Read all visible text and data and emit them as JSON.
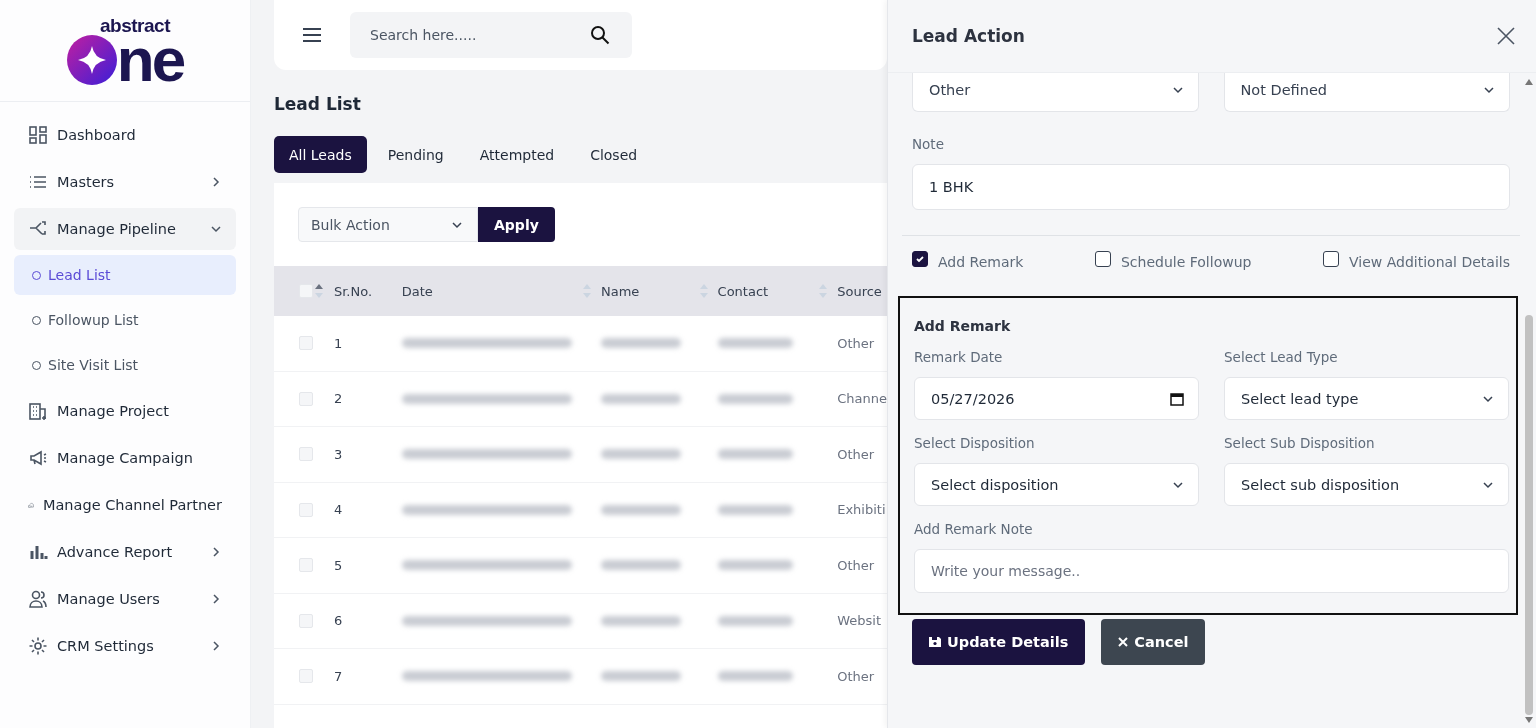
{
  "brand": {
    "top": "abstract",
    "main": "ne"
  },
  "sidebar": {
    "items": [
      {
        "label": "Dashboard",
        "selected": false
      },
      {
        "label": "Masters",
        "selected": false,
        "expanded": false
      },
      {
        "label": "Manage Pipeline",
        "selected": false,
        "expanded": true,
        "children": [
          {
            "label": "Lead List",
            "selected": true
          },
          {
            "label": "Followup List",
            "selected": false
          },
          {
            "label": "Site Visit List",
            "selected": false
          }
        ]
      },
      {
        "label": "Manage Project",
        "selected": false
      },
      {
        "label": "Manage Campaign",
        "selected": false
      },
      {
        "label": "Manage Channel Partner",
        "selected": false
      },
      {
        "label": "Advance Report",
        "selected": false,
        "expanded": false
      },
      {
        "label": "Manage Users",
        "selected": false,
        "expanded": false
      },
      {
        "label": "CRM Settings",
        "selected": false,
        "expanded": false
      }
    ]
  },
  "search": {
    "placeholder": "Search here....."
  },
  "page_title": "Lead List",
  "tabs": [
    {
      "label": "All Leads",
      "selected": true
    },
    {
      "label": "Pending",
      "selected": false
    },
    {
      "label": "Attempted",
      "selected": false
    },
    {
      "label": "Closed",
      "selected": false
    }
  ],
  "bulk_action": {
    "value": "Bulk Action"
  },
  "apply_button": "Apply",
  "table": {
    "columns": [
      "Sr.No.",
      "Date",
      "Name",
      "Contact",
      "Source"
    ],
    "select_all": {
      "checked": false
    },
    "rows": [
      {
        "sr": "1",
        "source": "Other",
        "checked": false
      },
      {
        "sr": "2",
        "source": "Channe",
        "checked": false
      },
      {
        "sr": "3",
        "source": "Other",
        "checked": false
      },
      {
        "sr": "4",
        "source": "Exhibiti",
        "checked": false
      },
      {
        "sr": "5",
        "source": "Other",
        "checked": false
      },
      {
        "sr": "6",
        "source": "Websit",
        "checked": false
      },
      {
        "sr": "7",
        "source": "Other",
        "checked": false
      }
    ]
  },
  "drawer": {
    "title": "Lead Action",
    "top_selects": [
      "Other",
      "Not Defined"
    ],
    "note": {
      "label": "Note",
      "value": "1 BHK"
    },
    "options": [
      {
        "label": "Add Remark",
        "checked": true
      },
      {
        "label": "Schedule Followup",
        "checked": false
      },
      {
        "label": "View Additional Details",
        "checked": false
      }
    ],
    "remark": {
      "title": "Add Remark",
      "fields": [
        {
          "kind": "date",
          "label": "Remark Date",
          "value": "05/27/2026"
        },
        {
          "kind": "select",
          "label": "Select Lead Type",
          "value": "Select lead type"
        },
        {
          "kind": "select",
          "label": "Select Disposition",
          "value": "Select disposition"
        },
        {
          "kind": "select",
          "label": "Select Sub Disposition",
          "value": "Select sub disposition"
        }
      ],
      "note_label": "Add Remark Note",
      "note_placeholder": "Write your message.."
    },
    "buttons": [
      {
        "kind": "primary",
        "label": "Update Details"
      },
      {
        "kind": "secondary",
        "label": "Cancel"
      }
    ]
  }
}
